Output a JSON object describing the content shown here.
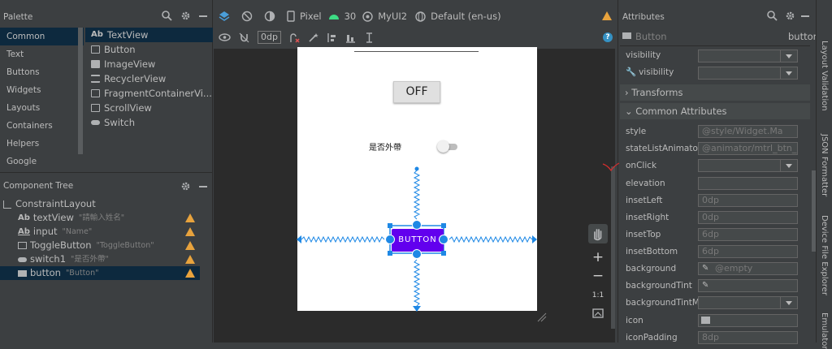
{
  "palette": {
    "title": "Palette",
    "categories": [
      "Common",
      "Text",
      "Buttons",
      "Widgets",
      "Layouts",
      "Containers",
      "Helpers",
      "Google"
    ],
    "items": [
      {
        "label": "TextView",
        "prefix": "Ab"
      },
      {
        "label": "Button"
      },
      {
        "label": "ImageView"
      },
      {
        "label": "RecyclerView"
      },
      {
        "label": "FragmentContainerVi..."
      },
      {
        "label": "ScrollView"
      },
      {
        "label": "Switch"
      }
    ]
  },
  "tree": {
    "title": "Component Tree",
    "root": "ConstraintLayout",
    "nodes": [
      {
        "name": "textView",
        "hint": "\"請輸入姓名\"",
        "prefix": "Ab"
      },
      {
        "name": "input",
        "hint": "\"Name\"",
        "prefix": "Ab"
      },
      {
        "name": "ToggleButton",
        "hint": "\"ToggleButton\""
      },
      {
        "name": "switch1",
        "hint": "\"是否外帶\""
      },
      {
        "name": "button",
        "hint": "\"Button\""
      }
    ]
  },
  "toolbar": {
    "device": "Pixel",
    "api": "30",
    "theme": "MyUI2",
    "locale": "Default (en-us)",
    "margin": "0dp"
  },
  "canvas": {
    "toggle_label": "OFF",
    "switch_label": "是否外帶",
    "button_label": "BUTTON"
  },
  "zoom": {
    "ratio": "1:1",
    "plus": "+",
    "minus": "−"
  },
  "attributes": {
    "title": "Attributes",
    "component": "Button",
    "component_id": "button",
    "top_rows": [
      {
        "label": "visibility",
        "value": "",
        "dropdown": true
      },
      {
        "label": "visibility",
        "value": "",
        "dropdown": true,
        "tool": true
      }
    ],
    "sections": [
      "Transforms",
      "Common Attributes"
    ],
    "rows": [
      {
        "label": "style",
        "value": "@style/Widget.Ma"
      },
      {
        "label": "stateListAnimator",
        "value": "@animator/mtrl_btn_st"
      },
      {
        "label": "onClick",
        "value": "",
        "dropdown": true
      },
      {
        "label": "elevation",
        "value": ""
      },
      {
        "label": "insetLeft",
        "value": "0dp"
      },
      {
        "label": "insetRight",
        "value": "0dp"
      },
      {
        "label": "insetTop",
        "value": "6dp"
      },
      {
        "label": "insetBottom",
        "value": "6dp"
      },
      {
        "label": "background",
        "value": "@empty"
      },
      {
        "label": "backgroundTint",
        "value": ""
      },
      {
        "label": "backgroundTintM...",
        "value": "",
        "dropdown": true
      },
      {
        "label": "icon",
        "value": ""
      },
      {
        "label": "iconPadding",
        "value": "8dp"
      }
    ]
  },
  "right_tabs": [
    "Layout Validation",
    "JSON Formatter",
    "Device File Explorer",
    "Emulator"
  ],
  "colors": {
    "accent": "#6200ee",
    "blueprint": "#1e88e5",
    "warning": "#e8a33d"
  }
}
